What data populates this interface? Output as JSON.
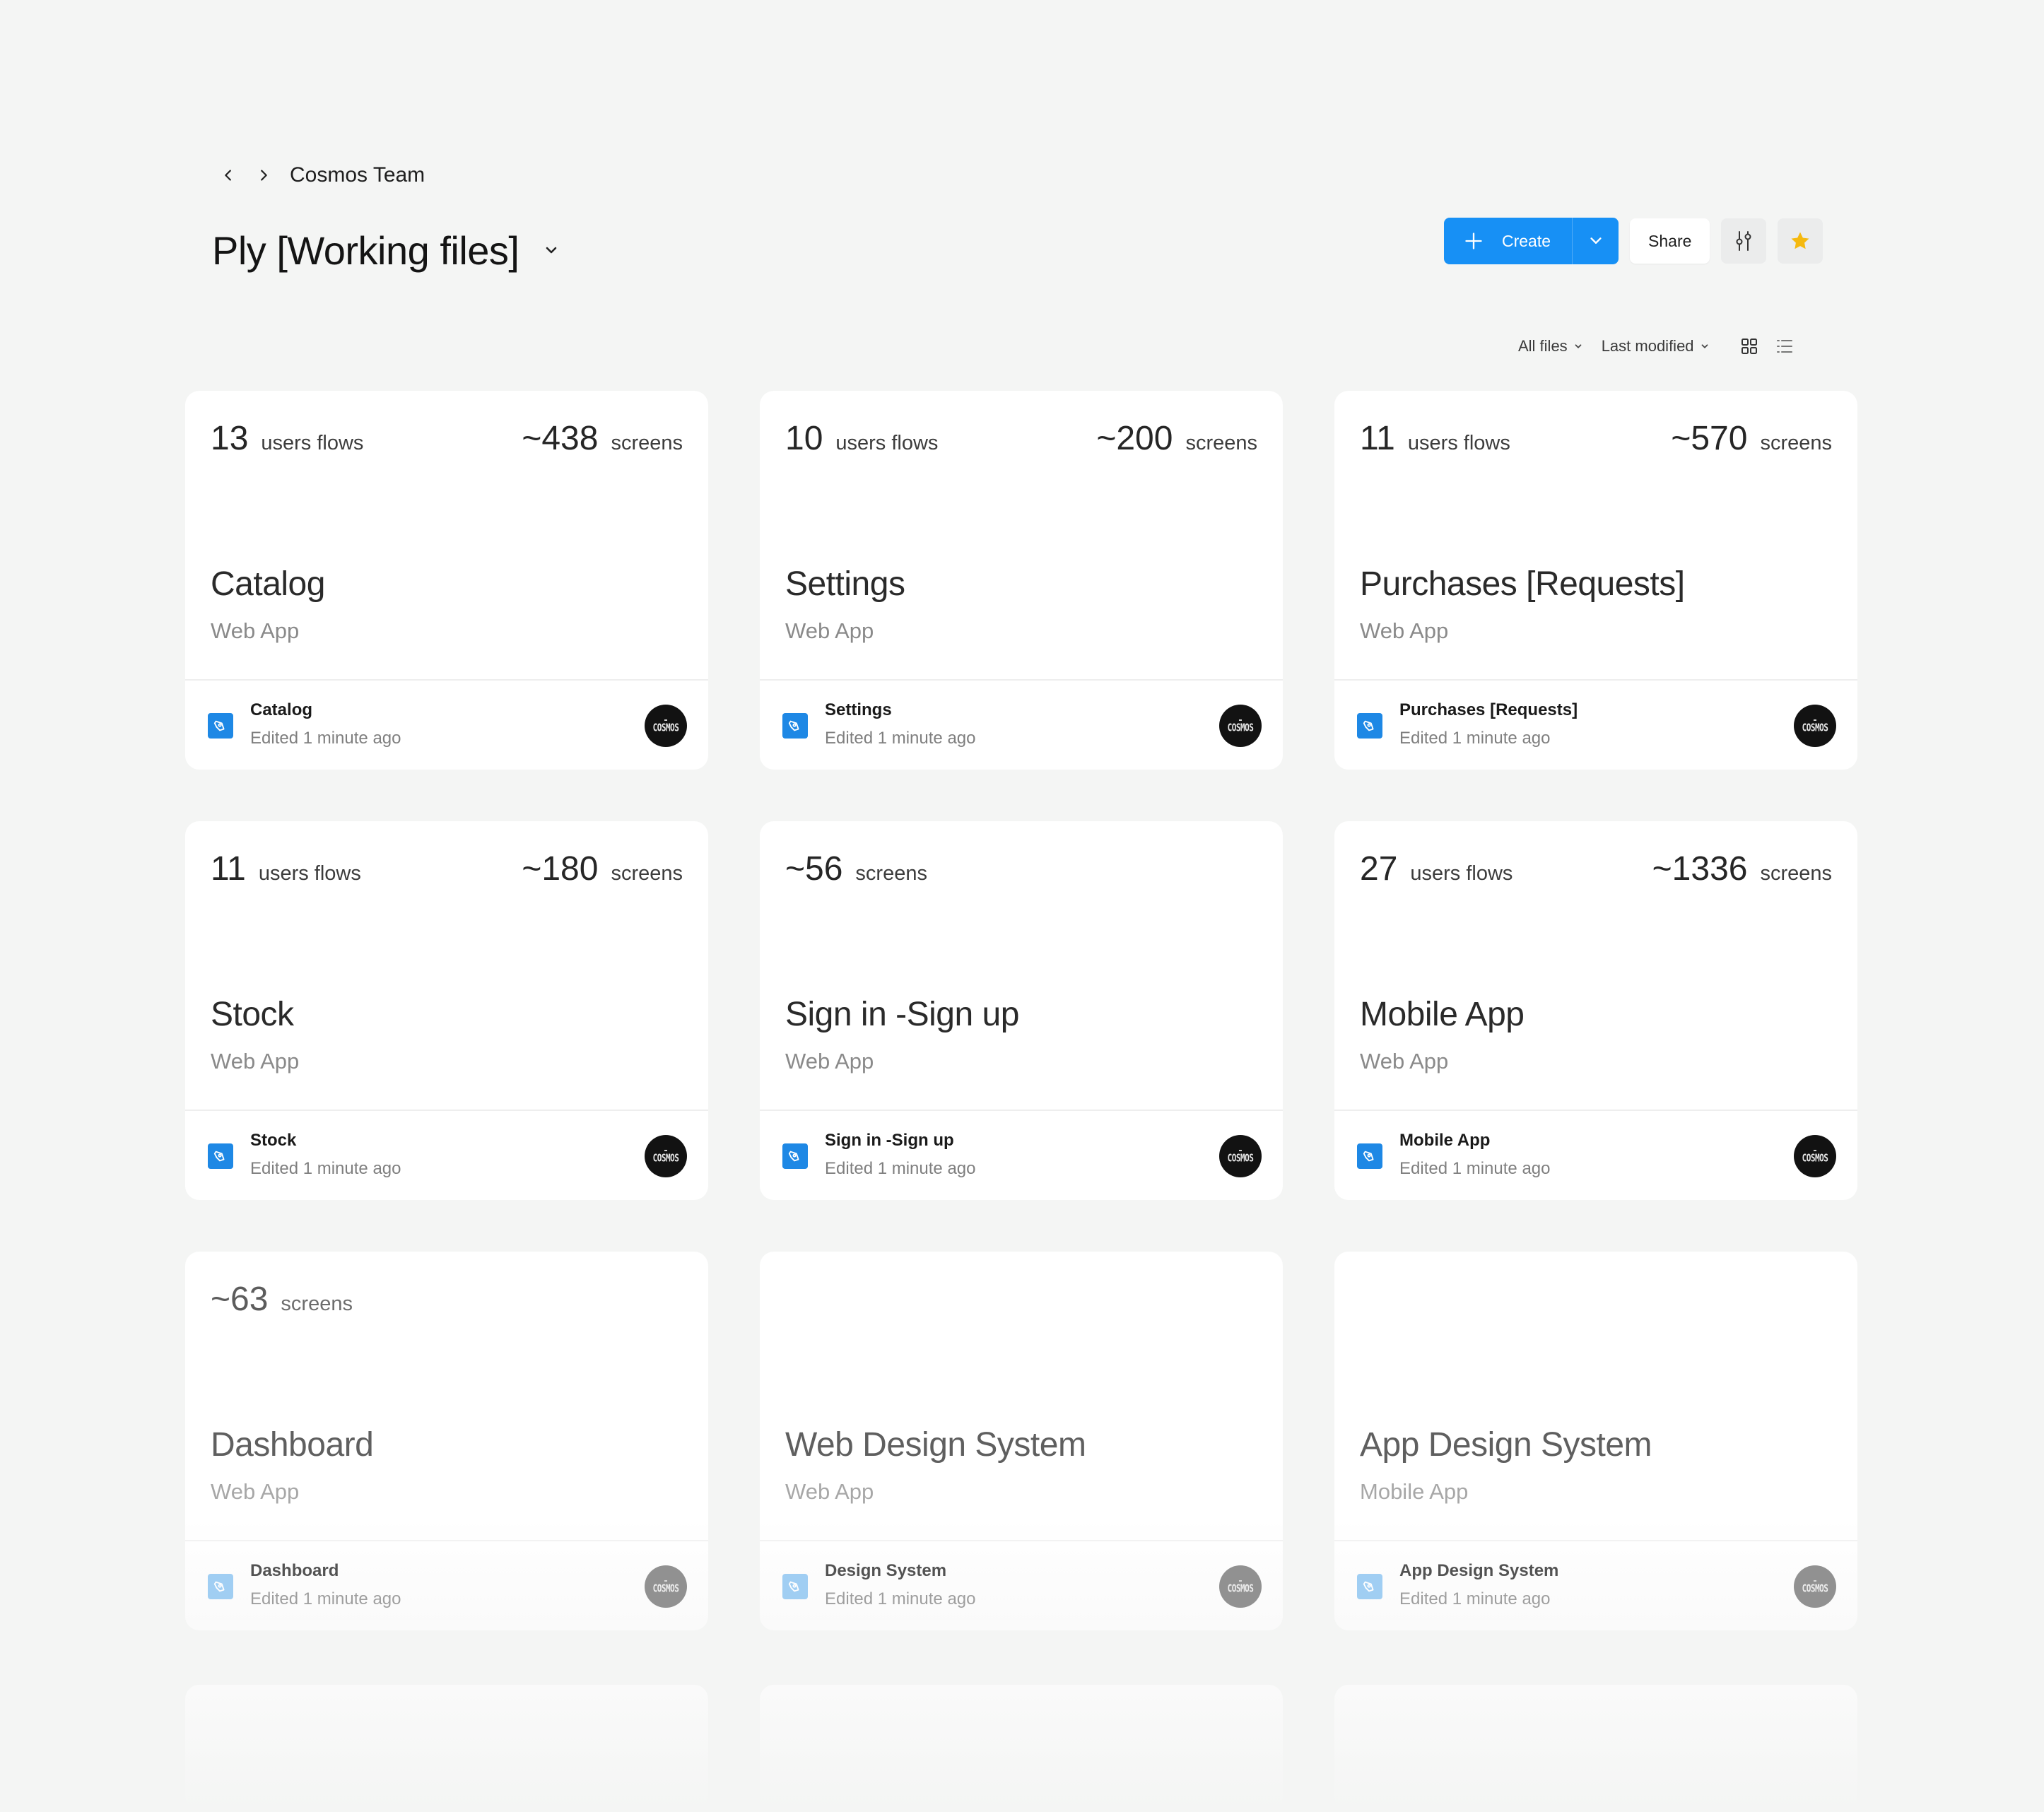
{
  "breadcrumb": {
    "team": "Cosmos Team"
  },
  "page": {
    "title": "Ply [Working files]"
  },
  "toolbar": {
    "create_label": "Create",
    "share_label": "Share"
  },
  "filters": {
    "files": "All files",
    "sort": "Last modified"
  },
  "colors": {
    "accent": "#1790f5",
    "star": "#f5b90f",
    "file_icon": "#1e88e5",
    "background": "#f4f5f4"
  },
  "cards": [
    {
      "flows": "13",
      "flows_label": "users flows",
      "screens": "~438",
      "screens_label": "screens",
      "title": "Catalog",
      "subtitle": "Web App",
      "file_name": "Catalog",
      "edited": "Edited 1 minute ago",
      "avatar": "COSMOS"
    },
    {
      "flows": "10",
      "flows_label": "users flows",
      "screens": "~200",
      "screens_label": "screens",
      "title": "Settings",
      "subtitle": "Web App",
      "file_name": "Settings",
      "edited": "Edited 1 minute ago",
      "avatar": "COSMOS"
    },
    {
      "flows": "11",
      "flows_label": "users flows",
      "screens": "~570",
      "screens_label": "screens",
      "title": "Purchases [Requests]",
      "subtitle": "Web App",
      "file_name": "Purchases [Requests]",
      "edited": "Edited 1 minute ago",
      "avatar": "COSMOS"
    },
    {
      "flows": "11",
      "flows_label": "users flows",
      "screens": "~180",
      "screens_label": "screens",
      "title": "Stock",
      "subtitle": "Web App",
      "file_name": "Stock",
      "edited": "Edited 1 minute ago",
      "avatar": "COSMOS"
    },
    {
      "screens": "~56",
      "screens_label": "screens",
      "title": "Sign in -Sign up",
      "subtitle": "Web App",
      "file_name": "Sign in -Sign up",
      "edited": "Edited 1 minute ago",
      "avatar": "COSMOS"
    },
    {
      "flows": "27",
      "flows_label": "users flows",
      "screens": "~1336",
      "screens_label": "screens",
      "title": "Mobile App",
      "subtitle": "Web App",
      "file_name": "Mobile App",
      "edited": "Edited 1 minute ago",
      "avatar": "COSMOS"
    },
    {
      "screens": "~63",
      "screens_label": "screens",
      "title": "Dashboard",
      "subtitle": "Web App",
      "file_name": "Dashboard",
      "edited": "Edited 1 minute ago",
      "avatar": "COSMOS"
    },
    {
      "title": "Web Design System",
      "subtitle": "Web App",
      "file_name": "Design System",
      "edited": "Edited 1 minute ago",
      "avatar": "COSMOS"
    },
    {
      "title": "App Design System",
      "subtitle": "Mobile App",
      "file_name": "App Design System",
      "edited": "Edited 1 minute ago",
      "avatar": "COSMOS"
    }
  ]
}
